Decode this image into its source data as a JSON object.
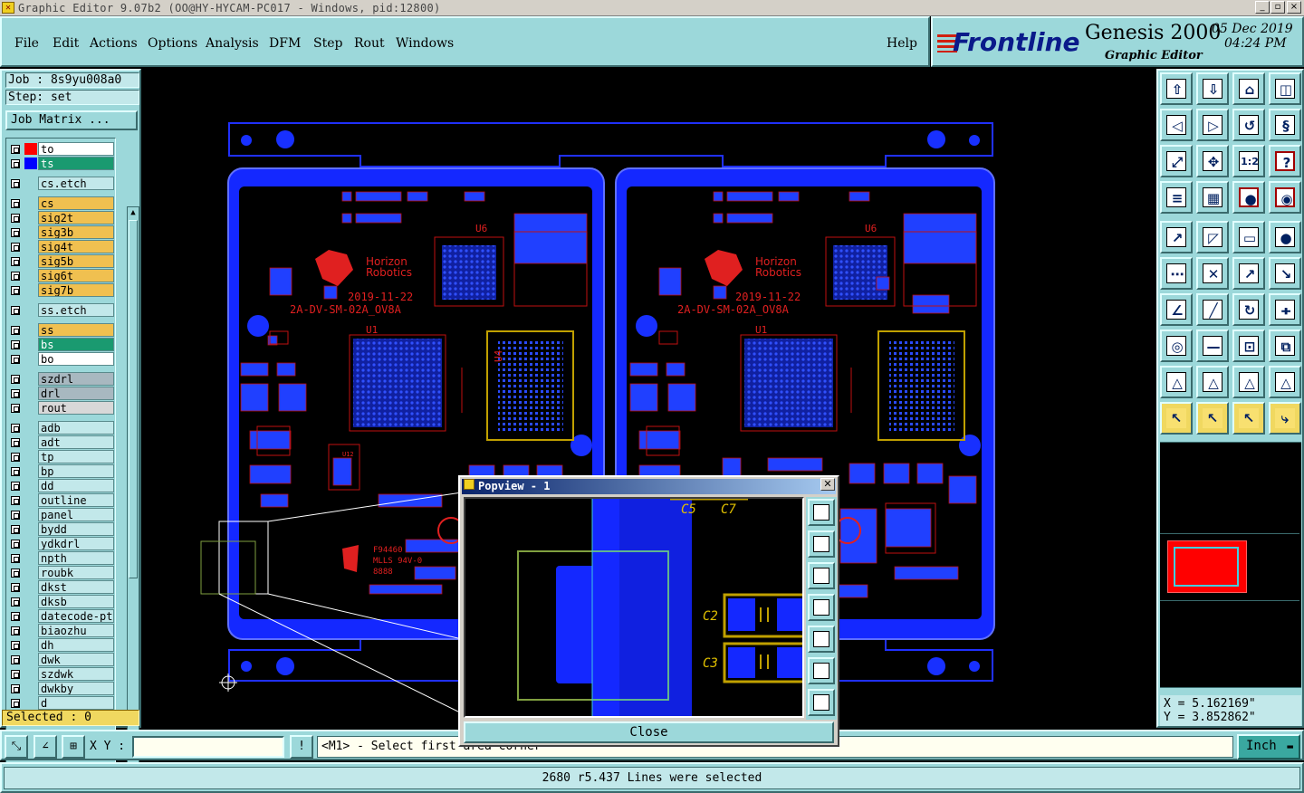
{
  "window": {
    "title": "Graphic Editor 9.07b2 (OO@HY-HYCAM-PC017 - Windows, pid:12800)",
    "minimize": "_",
    "restore": "▫",
    "close": "×"
  },
  "menu": {
    "items": [
      "File",
      "Edit",
      "Actions",
      "Options",
      "Analysis",
      "DFM",
      "Step",
      "Rout",
      "Windows"
    ],
    "help": "Help"
  },
  "brand": {
    "logo": "Frontline",
    "product": "Genesis 2000",
    "subtitle": "Graphic Editor",
    "date": "05 Dec 2019",
    "time": "04:24 PM"
  },
  "job": {
    "job_line": "Job : 8s9yu008a0",
    "step_line": "Step: set",
    "matrix_button": "Job Matrix ..."
  },
  "layers": [
    {
      "name": "to",
      "swatch": "#ff0000",
      "bg": "#ffffff"
    },
    {
      "name": "ts",
      "swatch": "#0000ff",
      "bg": "#1a9a70"
    },
    {
      "name": "cs.etch",
      "swatch": "",
      "bg": "#c2e8ea"
    },
    {
      "name": "cs",
      "swatch": "",
      "bg": "#f0c050"
    },
    {
      "name": "sig2t",
      "swatch": "",
      "bg": "#f0c050"
    },
    {
      "name": "sig3b",
      "swatch": "",
      "bg": "#f0c050"
    },
    {
      "name": "sig4t",
      "swatch": "",
      "bg": "#f0c050"
    },
    {
      "name": "sig5b",
      "swatch": "",
      "bg": "#f0c050"
    },
    {
      "name": "sig6t",
      "swatch": "",
      "bg": "#f0c050"
    },
    {
      "name": "sig7b",
      "swatch": "",
      "bg": "#f0c050"
    },
    {
      "name": "ss.etch",
      "swatch": "",
      "bg": "#c2e8ea"
    },
    {
      "name": "ss",
      "swatch": "",
      "bg": "#f0c050"
    },
    {
      "name": "bs",
      "swatch": "",
      "bg": "#1a9a70"
    },
    {
      "name": "bo",
      "swatch": "",
      "bg": "#ffffff"
    },
    {
      "name": "szdrl",
      "swatch": "",
      "bg": "#a8b8c0"
    },
    {
      "name": "drl",
      "swatch": "",
      "bg": "#a8b8c0"
    },
    {
      "name": "rout",
      "swatch": "",
      "bg": "#d8d8d8"
    },
    {
      "name": "adb",
      "swatch": "",
      "bg": "#c2e8ea"
    },
    {
      "name": "adt",
      "swatch": "",
      "bg": "#c2e8ea"
    },
    {
      "name": "tp",
      "swatch": "",
      "bg": "#c2e8ea"
    },
    {
      "name": "bp",
      "swatch": "",
      "bg": "#c2e8ea"
    },
    {
      "name": "dd",
      "swatch": "",
      "bg": "#c2e8ea"
    },
    {
      "name": "outline",
      "swatch": "",
      "bg": "#c2e8ea"
    },
    {
      "name": "panel",
      "swatch": "",
      "bg": "#c2e8ea"
    },
    {
      "name": "bydd",
      "swatch": "",
      "bg": "#c2e8ea"
    },
    {
      "name": "ydkdrl",
      "swatch": "",
      "bg": "#c2e8ea"
    },
    {
      "name": "npth",
      "swatch": "",
      "bg": "#c2e8ea"
    },
    {
      "name": "roubk",
      "swatch": "",
      "bg": "#c2e8ea"
    },
    {
      "name": "dkst",
      "swatch": "",
      "bg": "#c2e8ea"
    },
    {
      "name": "dksb",
      "swatch": "",
      "bg": "#c2e8ea"
    },
    {
      "name": "datecode-pt",
      "swatch": "",
      "bg": "#c2e8ea"
    },
    {
      "name": "biaozhu",
      "swatch": "",
      "bg": "#c2e8ea"
    },
    {
      "name": "dh",
      "swatch": "",
      "bg": "#c2e8ea"
    },
    {
      "name": "dwk",
      "swatch": "",
      "bg": "#c2e8ea"
    },
    {
      "name": "szdwk",
      "swatch": "",
      "bg": "#c2e8ea"
    },
    {
      "name": "dwkby",
      "swatch": "",
      "bg": "#c2e8ea"
    },
    {
      "name": "d",
      "swatch": "",
      "bg": "#c2e8ea"
    }
  ],
  "selected": "Selected : 0",
  "board": {
    "logo_line1": "Horizon",
    "logo_line2": "Robotics",
    "date_code": "2019-11-22",
    "part_number": "2A-DV-SM-02A_OV8A",
    "ref_u6": "U6",
    "ref_u1": "U1",
    "ref_u4": "U4",
    "ref_u12": "U12",
    "ul_code": "F94460",
    "ul_rating": "MLLS 94V-0",
    "ul_serial": "8888"
  },
  "coords": {
    "x": "X = 5.162169\"",
    "y": "Y = 3.852862\""
  },
  "command": {
    "xy_label": "X Y :",
    "xy_value": "",
    "prompt": "<M1> - Select first area corner",
    "units": "Inch"
  },
  "status": "2680 r5.437 Lines were selected",
  "popview": {
    "title": "Popview - 1",
    "close_label": "Close",
    "labels": [
      "C5",
      "C7",
      "C2",
      "C3"
    ]
  }
}
